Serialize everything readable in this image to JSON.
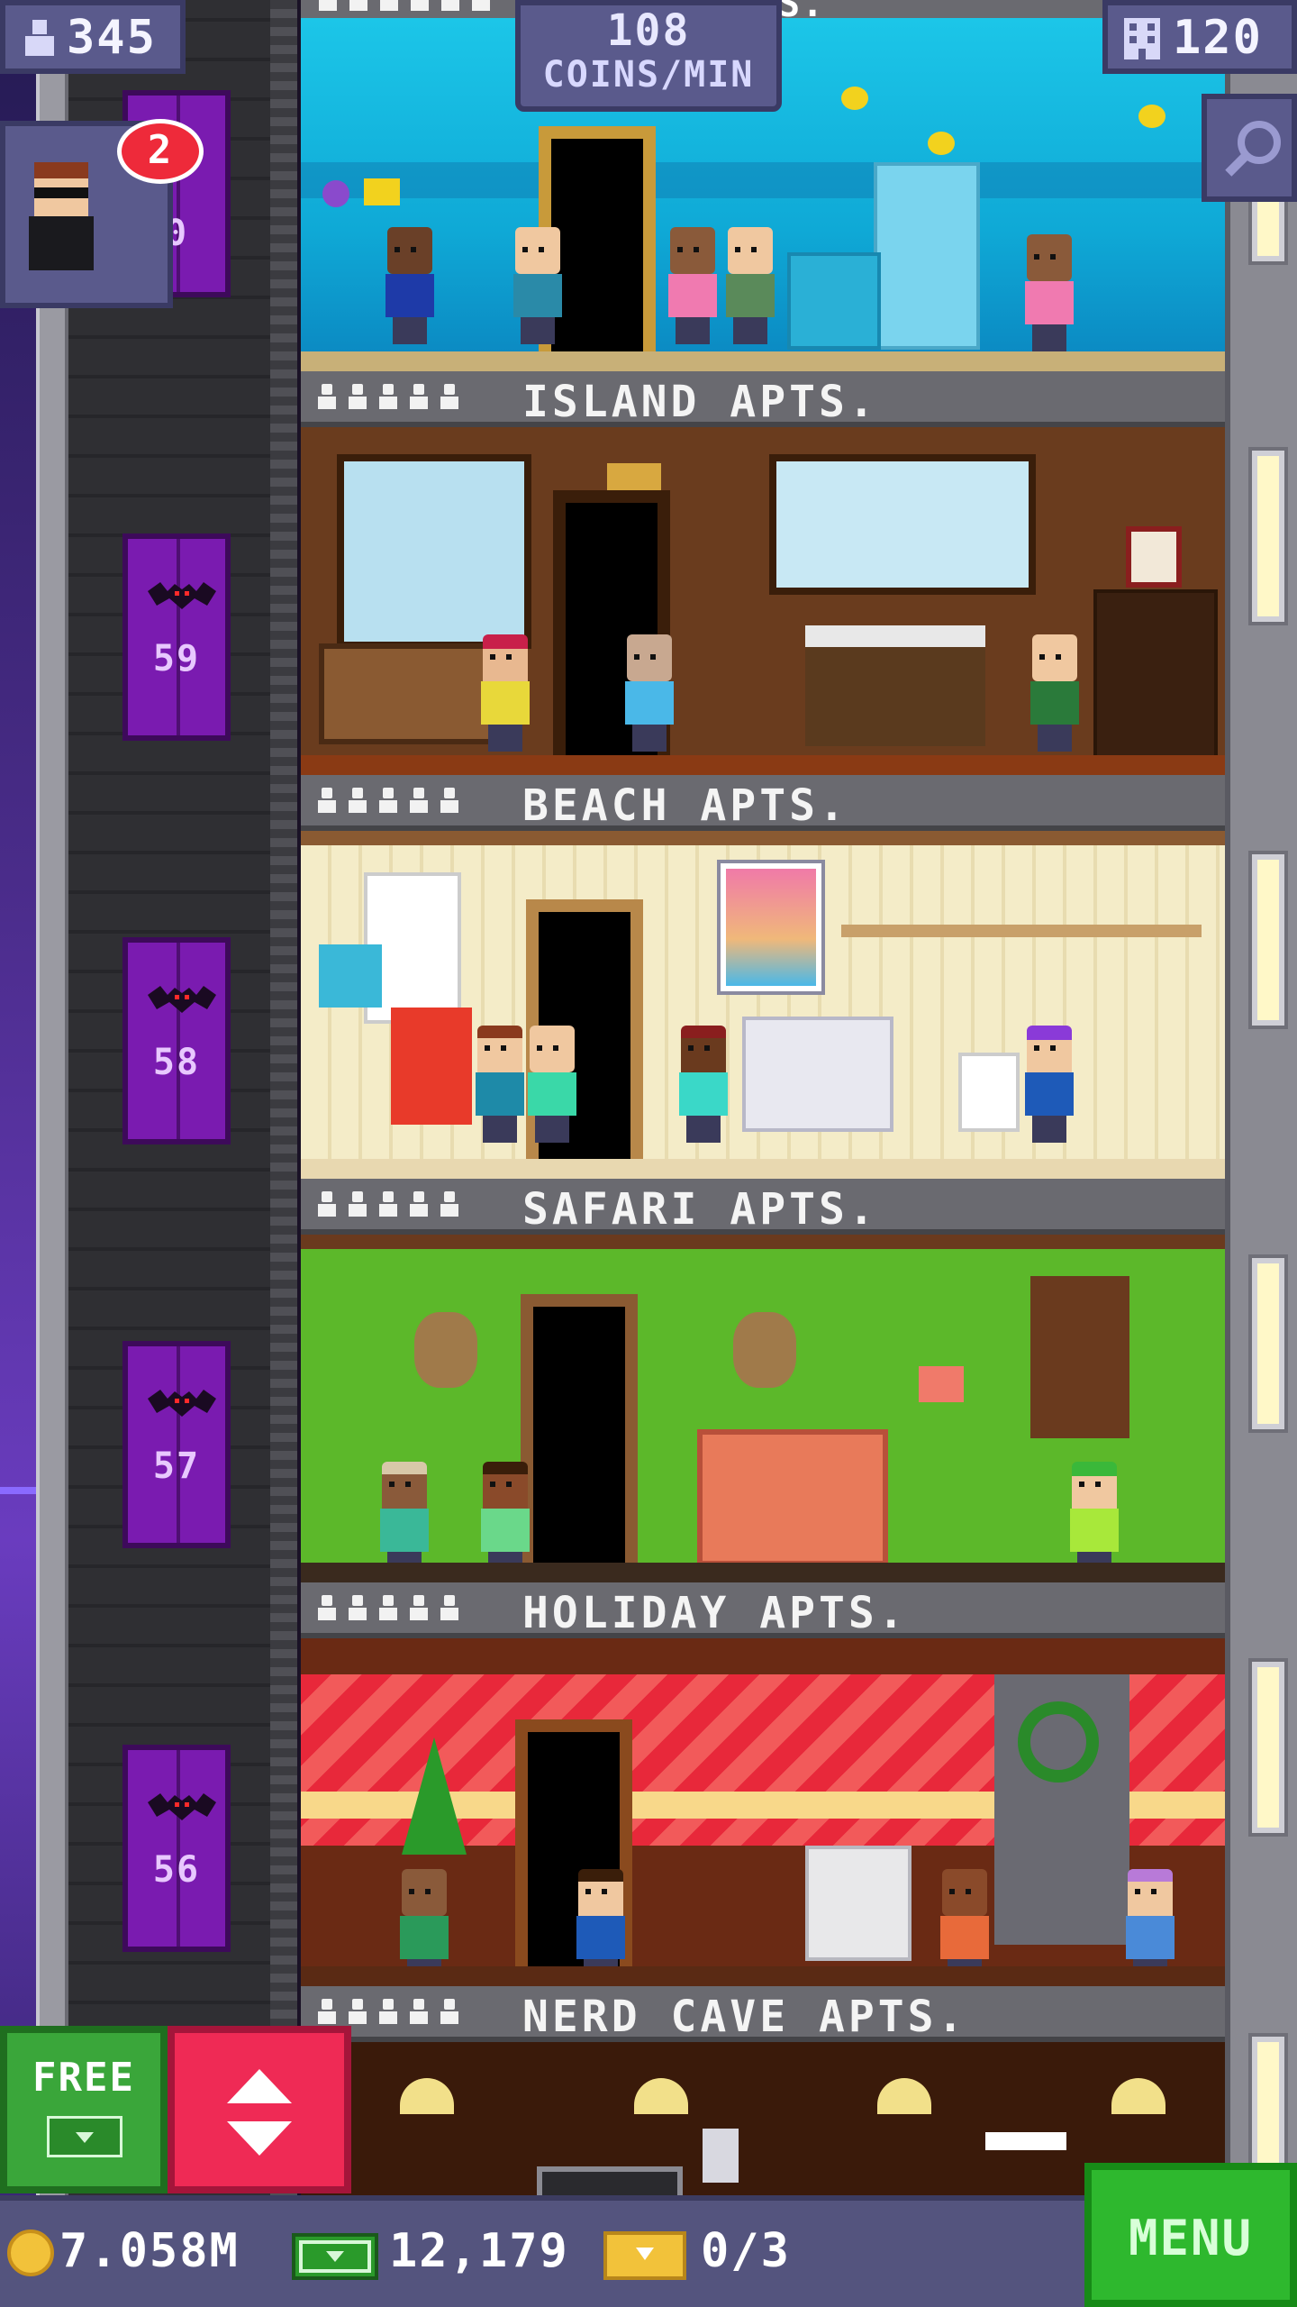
{
  "hud": {
    "population": "345",
    "coins_per_min_value": "108",
    "coins_per_min_label": "COINS/MIN",
    "floors_count": "120",
    "vip_badge_count": "2",
    "top_floor_label_fragment": "S."
  },
  "elevator": {
    "floor_numbers": [
      "0",
      "59",
      "58",
      "57",
      "56"
    ]
  },
  "floors": [
    {
      "name": "ISLAND APTS.",
      "stars": 5
    },
    {
      "name": "BEACH APTS.",
      "stars": 5
    },
    {
      "name": "SAFARI APTS.",
      "stars": 5
    },
    {
      "name": "HOLIDAY APTS.",
      "stars": 5
    },
    {
      "name": "NERD CAVE APTS.",
      "stars": 5
    }
  ],
  "buttons": {
    "free_label": "FREE",
    "menu_label": "MENU"
  },
  "bottom_bar": {
    "coins": "7.058M",
    "bux": "12,179",
    "tickets": "0/3"
  },
  "colors": {
    "elevator_purple": "#7a1bb0",
    "free_green": "#3aa63a",
    "lift_red": "#ef2a55",
    "menu_green": "#2eb82e",
    "hud_blue": "#5a5a8c"
  },
  "icons": [
    "population-icon",
    "floors-icon",
    "search-zoom-icon",
    "coin-icon",
    "bux-icon",
    "ticket-icon",
    "elevator-arrows-icon",
    "bat-icon"
  ]
}
